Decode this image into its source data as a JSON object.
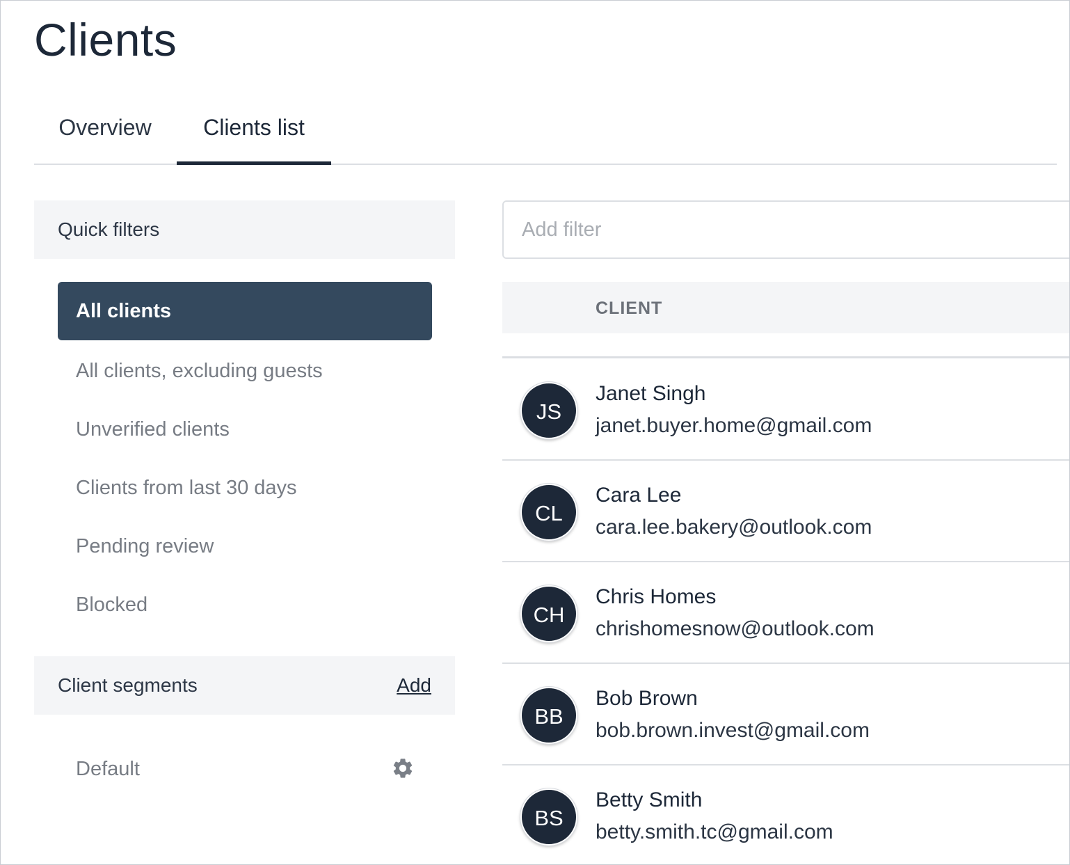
{
  "page": {
    "title": "Clients"
  },
  "tabs": [
    {
      "label": "Overview",
      "active": false
    },
    {
      "label": "Clients list",
      "active": true
    }
  ],
  "quick_filters": {
    "title": "Quick filters",
    "items": [
      {
        "label": "All clients",
        "active": true
      },
      {
        "label": "All clients, excluding guests",
        "active": false
      },
      {
        "label": "Unverified clients",
        "active": false
      },
      {
        "label": "Clients from last 30 days",
        "active": false
      },
      {
        "label": "Pending review",
        "active": false
      },
      {
        "label": "Blocked",
        "active": false
      }
    ]
  },
  "client_segments": {
    "title": "Client segments",
    "add_label": "Add",
    "items": [
      {
        "label": "Default",
        "icon": "gear-icon"
      }
    ]
  },
  "filter": {
    "placeholder": "Add filter",
    "value": ""
  },
  "table": {
    "column_header": "CLIENT",
    "rows": [
      {
        "initials": "JS",
        "name": "Janet Singh",
        "email": "janet.buyer.home@gmail.com"
      },
      {
        "initials": "CL",
        "name": "Cara Lee",
        "email": "cara.lee.bakery@outlook.com"
      },
      {
        "initials": "CH",
        "name": "Chris Homes",
        "email": "chrishomesnow@outlook.com"
      },
      {
        "initials": "BB",
        "name": "Bob Brown",
        "email": "bob.brown.invest@gmail.com"
      },
      {
        "initials": "BS",
        "name": "Betty Smith",
        "email": "betty.smith.tc@gmail.com"
      }
    ]
  },
  "colors": {
    "accent": "#34495e",
    "avatar": "#1d2838",
    "panel_bg": "#f4f5f7",
    "muted_text": "#777c84"
  }
}
